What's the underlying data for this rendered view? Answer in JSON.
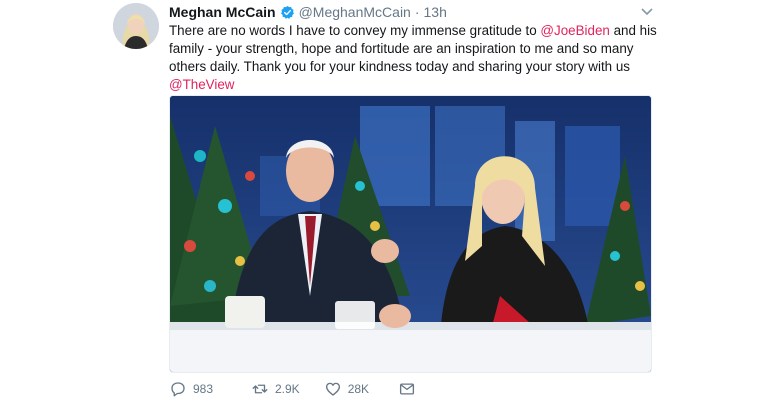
{
  "tweet": {
    "author_name": "Meghan McCain",
    "author_handle": "@MeghanMcCain",
    "separator": "·",
    "timestamp": "13h",
    "text": {
      "part1": "There are no words I have to convey my immense gratitude to ",
      "mention1": "@JoeBiden",
      "part2": " and his family - your strength, hope and fortitude are an inspiration to me and so many others daily. Thank you for your kindness today and sharing your story with us ",
      "mention2": "@TheView"
    },
    "actions": {
      "reply_count": "983",
      "retweet_count": "2.9K",
      "like_count": "28K"
    }
  },
  "colors": {
    "mention": "#e0245e",
    "verified": "#1da1f2",
    "muted": "#657786"
  },
  "icons": [
    "verified-badge-icon",
    "caret-down-icon",
    "reply-icon",
    "retweet-icon",
    "like-icon",
    "direct-message-icon"
  ]
}
